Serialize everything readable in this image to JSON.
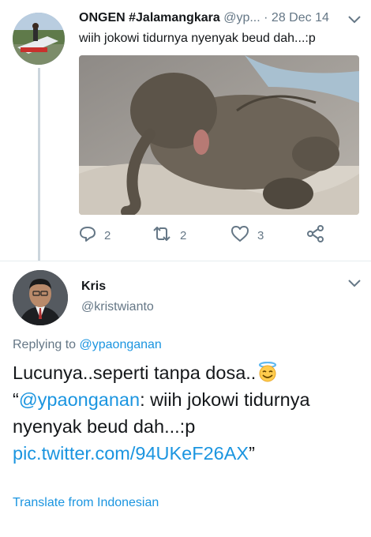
{
  "parent_tweet": {
    "display_name": "ONGEN #Jalamangkara",
    "handle": "@yp...",
    "separator": "·",
    "date": "28 Dec 14",
    "text": "wiih jokowi tidurnya nyenyak beud dah...:p",
    "actions": {
      "replies": "2",
      "retweets": "2",
      "likes": "3"
    }
  },
  "reply_tweet": {
    "display_name": "Kris",
    "handle": "@kristwianto",
    "replying_prefix": "Replying to ",
    "replying_to": "@ypaonganan",
    "text_line1": "Lucunya..seperti tanpa dosa..",
    "quote_open": "“",
    "quoted_handle": "@ypaonganan",
    "quoted_text": ": wiih jokowi tidurnya nyenyak beud dah...:p ",
    "link": "pic.twitter.com/94UKeF26AX",
    "quote_close": "”",
    "translate_label": "Translate from Indonesian"
  },
  "colors": {
    "link": "#1b95e0",
    "muted": "#657786",
    "text": "#14171a",
    "divider": "#e6ecf0"
  },
  "icons": [
    "reply-icon",
    "retweet-icon",
    "like-icon",
    "share-icon",
    "chevron-down-icon",
    "halo-emoji-icon"
  ]
}
